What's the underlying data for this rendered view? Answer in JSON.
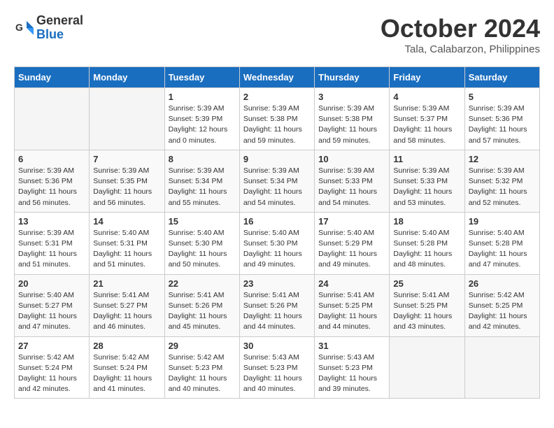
{
  "header": {
    "logo_line1": "General",
    "logo_line2": "Blue",
    "month": "October 2024",
    "location": "Tala, Calabarzon, Philippines"
  },
  "weekdays": [
    "Sunday",
    "Monday",
    "Tuesday",
    "Wednesday",
    "Thursday",
    "Friday",
    "Saturday"
  ],
  "weeks": [
    [
      {
        "day": "",
        "info": ""
      },
      {
        "day": "",
        "info": ""
      },
      {
        "day": "1",
        "info": "Sunrise: 5:39 AM\nSunset: 5:39 PM\nDaylight: 12 hours\nand 0 minutes."
      },
      {
        "day": "2",
        "info": "Sunrise: 5:39 AM\nSunset: 5:38 PM\nDaylight: 11 hours\nand 59 minutes."
      },
      {
        "day": "3",
        "info": "Sunrise: 5:39 AM\nSunset: 5:38 PM\nDaylight: 11 hours\nand 59 minutes."
      },
      {
        "day": "4",
        "info": "Sunrise: 5:39 AM\nSunset: 5:37 PM\nDaylight: 11 hours\nand 58 minutes."
      },
      {
        "day": "5",
        "info": "Sunrise: 5:39 AM\nSunset: 5:36 PM\nDaylight: 11 hours\nand 57 minutes."
      }
    ],
    [
      {
        "day": "6",
        "info": "Sunrise: 5:39 AM\nSunset: 5:36 PM\nDaylight: 11 hours\nand 56 minutes."
      },
      {
        "day": "7",
        "info": "Sunrise: 5:39 AM\nSunset: 5:35 PM\nDaylight: 11 hours\nand 56 minutes."
      },
      {
        "day": "8",
        "info": "Sunrise: 5:39 AM\nSunset: 5:34 PM\nDaylight: 11 hours\nand 55 minutes."
      },
      {
        "day": "9",
        "info": "Sunrise: 5:39 AM\nSunset: 5:34 PM\nDaylight: 11 hours\nand 54 minutes."
      },
      {
        "day": "10",
        "info": "Sunrise: 5:39 AM\nSunset: 5:33 PM\nDaylight: 11 hours\nand 54 minutes."
      },
      {
        "day": "11",
        "info": "Sunrise: 5:39 AM\nSunset: 5:33 PM\nDaylight: 11 hours\nand 53 minutes."
      },
      {
        "day": "12",
        "info": "Sunrise: 5:39 AM\nSunset: 5:32 PM\nDaylight: 11 hours\nand 52 minutes."
      }
    ],
    [
      {
        "day": "13",
        "info": "Sunrise: 5:39 AM\nSunset: 5:31 PM\nDaylight: 11 hours\nand 51 minutes."
      },
      {
        "day": "14",
        "info": "Sunrise: 5:40 AM\nSunset: 5:31 PM\nDaylight: 11 hours\nand 51 minutes."
      },
      {
        "day": "15",
        "info": "Sunrise: 5:40 AM\nSunset: 5:30 PM\nDaylight: 11 hours\nand 50 minutes."
      },
      {
        "day": "16",
        "info": "Sunrise: 5:40 AM\nSunset: 5:30 PM\nDaylight: 11 hours\nand 49 minutes."
      },
      {
        "day": "17",
        "info": "Sunrise: 5:40 AM\nSunset: 5:29 PM\nDaylight: 11 hours\nand 49 minutes."
      },
      {
        "day": "18",
        "info": "Sunrise: 5:40 AM\nSunset: 5:28 PM\nDaylight: 11 hours\nand 48 minutes."
      },
      {
        "day": "19",
        "info": "Sunrise: 5:40 AM\nSunset: 5:28 PM\nDaylight: 11 hours\nand 47 minutes."
      }
    ],
    [
      {
        "day": "20",
        "info": "Sunrise: 5:40 AM\nSunset: 5:27 PM\nDaylight: 11 hours\nand 47 minutes."
      },
      {
        "day": "21",
        "info": "Sunrise: 5:41 AM\nSunset: 5:27 PM\nDaylight: 11 hours\nand 46 minutes."
      },
      {
        "day": "22",
        "info": "Sunrise: 5:41 AM\nSunset: 5:26 PM\nDaylight: 11 hours\nand 45 minutes."
      },
      {
        "day": "23",
        "info": "Sunrise: 5:41 AM\nSunset: 5:26 PM\nDaylight: 11 hours\nand 44 minutes."
      },
      {
        "day": "24",
        "info": "Sunrise: 5:41 AM\nSunset: 5:25 PM\nDaylight: 11 hours\nand 44 minutes."
      },
      {
        "day": "25",
        "info": "Sunrise: 5:41 AM\nSunset: 5:25 PM\nDaylight: 11 hours\nand 43 minutes."
      },
      {
        "day": "26",
        "info": "Sunrise: 5:42 AM\nSunset: 5:25 PM\nDaylight: 11 hours\nand 42 minutes."
      }
    ],
    [
      {
        "day": "27",
        "info": "Sunrise: 5:42 AM\nSunset: 5:24 PM\nDaylight: 11 hours\nand 42 minutes."
      },
      {
        "day": "28",
        "info": "Sunrise: 5:42 AM\nSunset: 5:24 PM\nDaylight: 11 hours\nand 41 minutes."
      },
      {
        "day": "29",
        "info": "Sunrise: 5:42 AM\nSunset: 5:23 PM\nDaylight: 11 hours\nand 40 minutes."
      },
      {
        "day": "30",
        "info": "Sunrise: 5:43 AM\nSunset: 5:23 PM\nDaylight: 11 hours\nand 40 minutes."
      },
      {
        "day": "31",
        "info": "Sunrise: 5:43 AM\nSunset: 5:23 PM\nDaylight: 11 hours\nand 39 minutes."
      },
      {
        "day": "",
        "info": ""
      },
      {
        "day": "",
        "info": ""
      }
    ]
  ]
}
